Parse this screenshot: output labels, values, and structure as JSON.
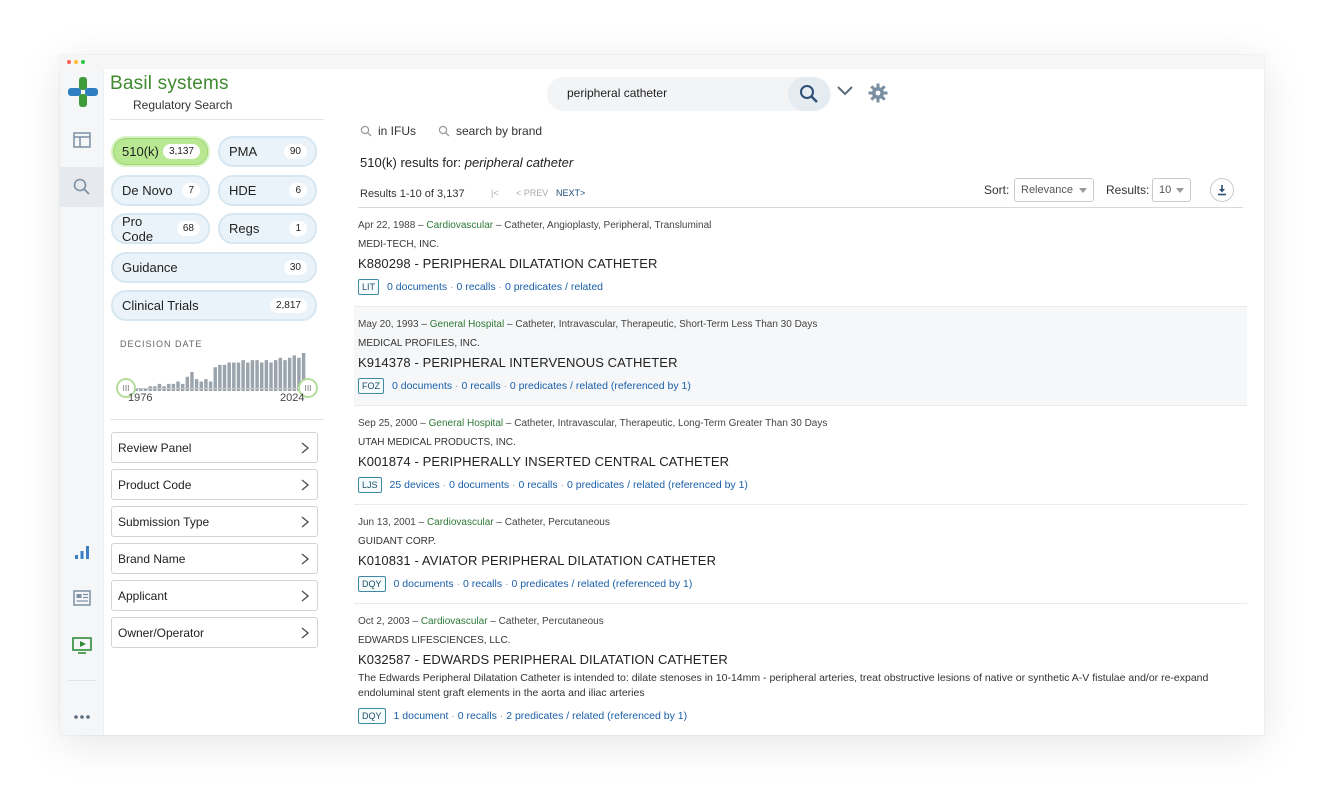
{
  "brand": {
    "name": "Basil systems",
    "subtitle": "Regulatory Search"
  },
  "search": {
    "query": "peripheral catheter",
    "placeholder": ""
  },
  "options": {
    "in_ifus": "in IFUs",
    "search_by_brand": "search by brand"
  },
  "categories": [
    {
      "label": "510(k)",
      "count": "3,137",
      "active": true
    },
    {
      "label": "PMA",
      "count": "90"
    },
    {
      "label": "De Novo",
      "count": "7"
    },
    {
      "label": "HDE",
      "count": "6"
    },
    {
      "label": "Pro Code",
      "count": "68"
    },
    {
      "label": "Regs",
      "count": "1"
    },
    {
      "label": "Guidance",
      "count": "30"
    },
    {
      "label": "Clinical Trials",
      "count": "2,817"
    }
  ],
  "decision_date": {
    "label": "DECISION DATE",
    "start_year": "1976",
    "end_year": "2024",
    "handle_glyph": "III",
    "histogram": [
      1,
      1,
      0,
      1,
      1,
      1,
      2,
      2,
      3,
      2,
      3,
      3,
      4,
      3,
      6,
      8,
      5,
      4,
      5,
      4,
      10,
      11,
      11,
      12,
      12,
      12,
      13,
      12,
      13,
      13,
      12,
      13,
      12,
      13,
      14,
      13,
      14,
      15,
      14,
      16
    ]
  },
  "facets": [
    "Review Panel",
    "Product Code",
    "Submission Type",
    "Brand Name",
    "Applicant",
    "Owner/Operator"
  ],
  "results_header": {
    "prefix": "510(k) results for: ",
    "query": "peripheral catheter"
  },
  "pager": {
    "summary": "Results 1-10 of 3,137",
    "first": "|<",
    "prev": "< PREV",
    "next": "NEXT>"
  },
  "sort": {
    "label": "Sort:",
    "value": "Relevance",
    "results_label": "Results:",
    "results_value": "10"
  },
  "results": [
    {
      "date": "Apr 22, 1988",
      "category": "Cardiovascular",
      "device": "Catheter, Angioplasty, Peripheral, Transluminal",
      "company": "MEDI-TECH, INC.",
      "title": "K880298 - PERIPHERAL DILATATION CATHETER",
      "tag": "LIT",
      "links": [
        "0 documents",
        "0 recalls",
        "0 predicates / related"
      ]
    },
    {
      "date": "May 20, 1993",
      "category": "General Hospital",
      "device": "Catheter, Intravascular, Therapeutic, Short-Term Less Than 30 Days",
      "company": "MEDICAL PROFILES, INC.",
      "title": "K914378 - PERIPHERAL INTERVENOUS CATHETER",
      "tag": "FOZ",
      "links": [
        "0 documents",
        "0 recalls",
        "0 predicates / related (referenced by 1)"
      ]
    },
    {
      "date": "Sep 25, 2000",
      "category": "General Hospital",
      "device": "Catheter, Intravascular, Therapeutic, Long-Term Greater Than 30 Days",
      "company": "UTAH MEDICAL PRODUCTS, INC.",
      "title": "K001874 - PERIPHERALLY INSERTED CENTRAL CATHETER",
      "tag": "LJS",
      "links": [
        "25 devices",
        "0 documents",
        "0 recalls",
        "0 predicates / related (referenced by 1)"
      ]
    },
    {
      "date": "Jun 13, 2001",
      "category": "Cardiovascular",
      "device": "Catheter, Percutaneous",
      "company": "GUIDANT CORP.",
      "title": "K010831 - AVIATOR PERIPHERAL DILATATION CATHETER",
      "tag": "DQY",
      "links": [
        "0 documents",
        "0 recalls",
        "0 predicates / related (referenced by 1)"
      ]
    },
    {
      "date": "Oct 2, 2003",
      "category": "Cardiovascular",
      "device": "Catheter, Percutaneous",
      "company": "EDWARDS LIFESCIENCES, LLC.",
      "title": "K032587 - EDWARDS PERIPHERAL DILATATION CATHETER",
      "description": "The Edwards Peripheral Dilatation Catheter is intended to: dilate stenoses in 10-14mm - peripheral arteries, treat obstructive lesions of native or synthetic A-V fistulae and/or re-expand endoluminal stent graft elements in the aorta and iliac arteries",
      "tag": "DQY",
      "links": [
        "1 document",
        "0 recalls",
        "2 predicates / related (referenced by 1)"
      ]
    }
  ],
  "colors": {
    "brand_green": "#3f8a2e",
    "active_pill": "#b8e892",
    "pill": "#eaf3f9",
    "link": "#1a5fa8",
    "category": "#2f7a38"
  },
  "icons": {
    "rail": [
      "table-icon",
      "search-icon",
      "analytics-icon",
      "news-icon",
      "video-icon",
      "more-icon"
    ],
    "toolbar": [
      "search-icon",
      "chevron-down-icon",
      "gear-icon",
      "download-icon"
    ]
  }
}
